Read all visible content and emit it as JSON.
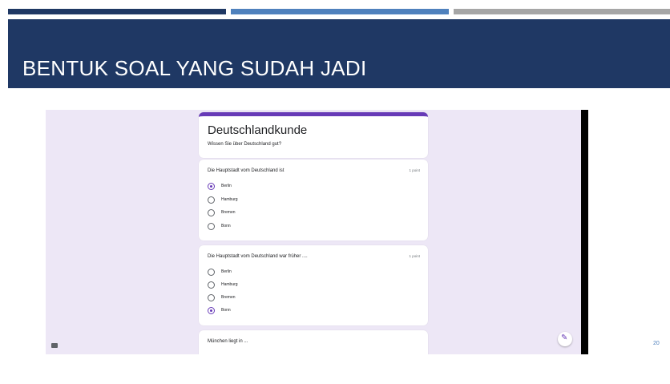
{
  "slide": {
    "title": "BENTUK SOAL YANG SUDAH JADI",
    "page_number": "20",
    "colors": {
      "header": "#1f3864",
      "accent_blue": "#4f81bd",
      "accent_gray": "#a6a6a6"
    }
  },
  "form": {
    "title": "Deutschlandkunde",
    "description": "Wissen Sie über Deutschland gut?",
    "accent_color": "#673ab7",
    "questions": [
      {
        "text": "Die Hauptstadt vom Deutschland ist",
        "points": "1 point",
        "options": [
          "Berlin",
          "Hamburg",
          "Bremen",
          "Bonn"
        ],
        "selected": "Berlin"
      },
      {
        "text": "Die Hauptstadt vom Deutschland war früher ....",
        "points": "1 point",
        "options": [
          "Berlin",
          "Hamburg",
          "Bremen",
          "Bonn"
        ],
        "selected": "Bonn"
      },
      {
        "text": "München liegt in ..."
      }
    ],
    "icons": {
      "feedback": "feedback-icon",
      "edit": "pencil-icon"
    }
  }
}
